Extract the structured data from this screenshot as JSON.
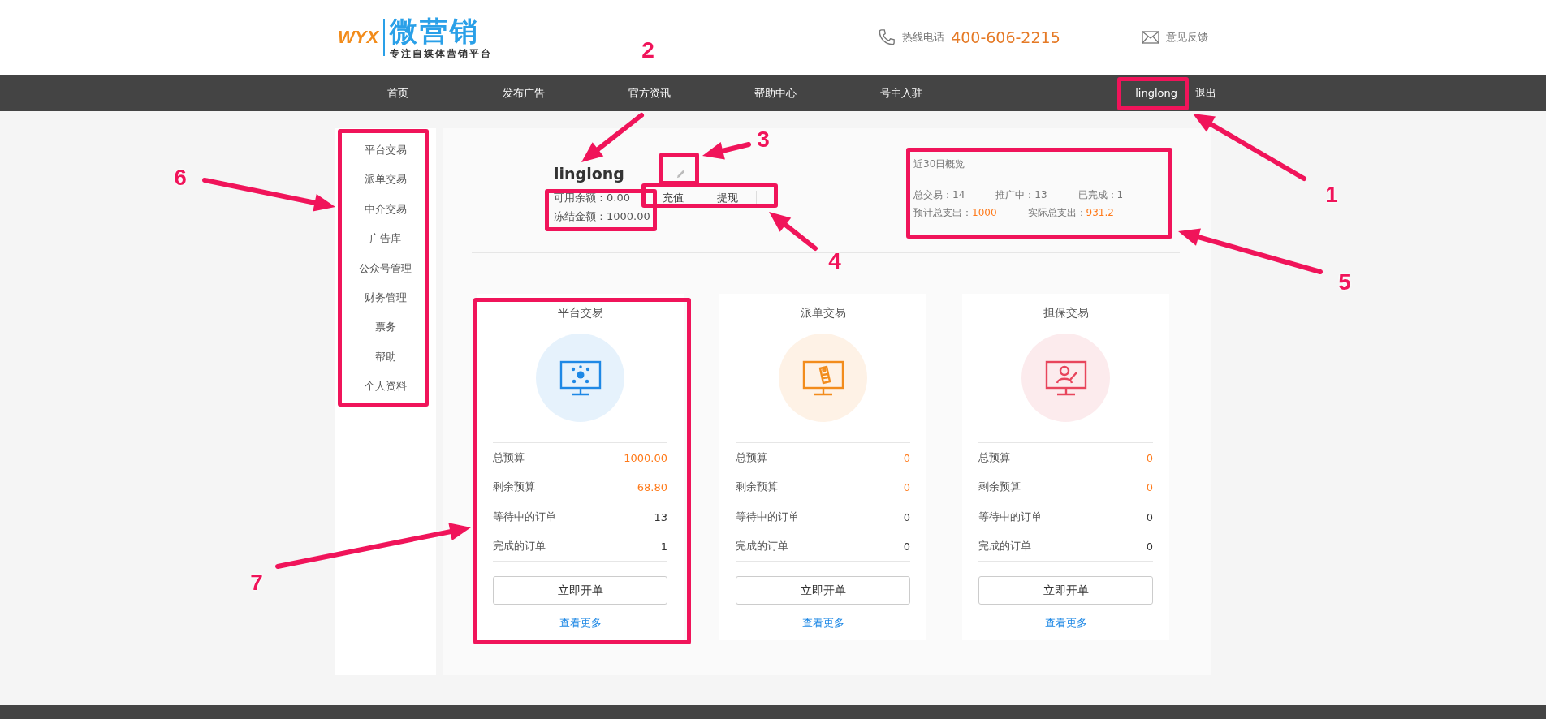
{
  "header": {
    "logo": {
      "mark": "WYX",
      "name": "微营销",
      "slogan": "专注自媒体营销平台"
    },
    "hotline": {
      "label": "热线电话",
      "number": "400-606-2215"
    },
    "feedback": "意见反馈"
  },
  "nav": {
    "items": [
      "首页",
      "发布广告",
      "官方资讯",
      "帮助中心",
      "号主入驻"
    ],
    "user": "linglong",
    "logout": "退出"
  },
  "sidebar": {
    "items": [
      "平台交易",
      "派单交易",
      "中介交易",
      "广告库",
      "公众号管理",
      "财务管理",
      "票务",
      "帮助",
      "个人资料"
    ]
  },
  "profile": {
    "username": "linglong",
    "available": "可用余额：0.00",
    "frozen": "冻结金额：1000.00",
    "buttons": [
      "充值",
      "提现"
    ]
  },
  "overview": {
    "title": "近30日概览",
    "rows": [
      {
        "items": [
          {
            "label": "总交易：",
            "value": "14",
            "highlight": false
          },
          {
            "label": "推广中：",
            "value": "13",
            "highlight": false
          },
          {
            "label": "已完成：",
            "value": "1",
            "highlight": false
          }
        ]
      },
      {
        "items": [
          {
            "label": "预计总支出：",
            "value": "1000",
            "highlight": true
          },
          {
            "label": "实际总支出：",
            "value": "931.2",
            "highlight": true
          }
        ]
      }
    ]
  },
  "cards": [
    {
      "title": "平台交易",
      "kind": "network",
      "color": "#1e88e5",
      "rows": [
        {
          "label": "总预算",
          "value": "1000.00",
          "highlight": true
        },
        {
          "label": "剩余预算",
          "value": "68.80",
          "highlight": true
        },
        {
          "label": "等待中的订单",
          "value": "13",
          "highlight": false
        },
        {
          "label": "完成的订单",
          "value": "1",
          "highlight": false
        }
      ],
      "button": "立即开单",
      "link": "查看更多"
    },
    {
      "title": "派单交易",
      "kind": "tag",
      "color": "#f28c1c",
      "rows": [
        {
          "label": "总预算",
          "value": "0",
          "highlight": true
        },
        {
          "label": "剩余预算",
          "value": "0",
          "highlight": true
        },
        {
          "label": "等待中的订单",
          "value": "0",
          "highlight": false
        },
        {
          "label": "完成的订单",
          "value": "0",
          "highlight": false
        }
      ],
      "button": "立即开单",
      "link": "查看更多"
    },
    {
      "title": "担保交易",
      "kind": "person",
      "color": "#e8455c",
      "rows": [
        {
          "label": "总预算",
          "value": "0",
          "highlight": true
        },
        {
          "label": "剩余预算",
          "value": "0",
          "highlight": true
        },
        {
          "label": "等待中的订单",
          "value": "0",
          "highlight": false
        },
        {
          "label": "完成的订单",
          "value": "0",
          "highlight": false
        }
      ],
      "button": "立即开单",
      "link": "查看更多"
    }
  ],
  "annotations": [
    {
      "number": "1"
    },
    {
      "number": "2"
    },
    {
      "number": "3"
    },
    {
      "number": "4"
    },
    {
      "number": "5"
    },
    {
      "number": "6"
    },
    {
      "number": "7"
    }
  ]
}
